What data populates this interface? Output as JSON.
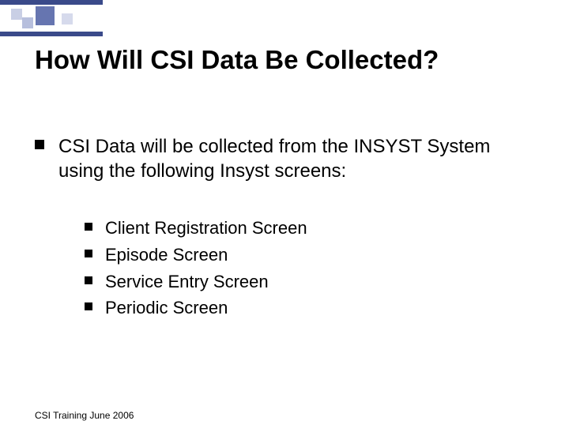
{
  "title": "How Will CSI Data Be Collected?",
  "intro": "CSI Data will be collected from the INSYST System using the following Insyst screens:",
  "items": [
    "Client Registration Screen",
    "Episode Screen",
    "Service Entry Screen",
    "Periodic Screen"
  ],
  "footer": "CSI Training June 2006"
}
